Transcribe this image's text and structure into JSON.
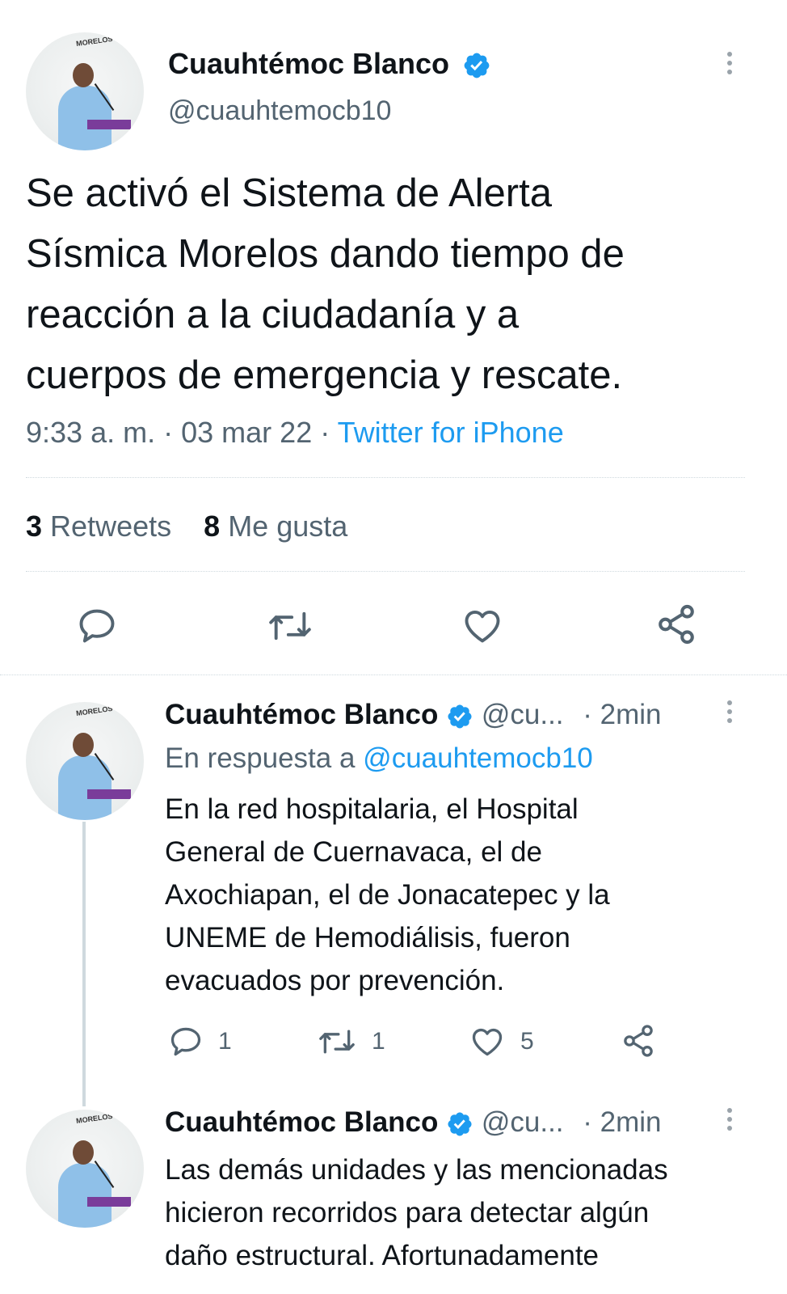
{
  "main_tweet": {
    "author_name": "Cuauhtémoc Blanco",
    "handle": "@cuauhtemocb10",
    "avatar_tag": "MORELOS",
    "text": "Se activó el Sistema de Alerta\nSísmica Morelos dando tiempo de\nreacción a la ciudadanía y a\ncuerpos de emergencia y rescate.",
    "time": "9:33 a. m.",
    "date": "03 mar 22",
    "separator": "·",
    "source": "Twitter for iPhone",
    "retweets_count": "3",
    "retweets_label": "Retweets",
    "likes_count": "8",
    "likes_label": "Me gusta"
  },
  "reply_1": {
    "author_name": "Cuauhtémoc Blanco",
    "handle": "@cu...",
    "time": "· 2min",
    "in_reply_prefix": "En respuesta a",
    "in_reply_handle": "@cuauhtemocb10",
    "text": "En la red hospitalaria, el Hospital\nGeneral de Cuernavaca, el de\nAxochiapan, el de Jonacatepec y la\nUNEME de Hemodiálisis, fueron\nevacuados por prevención.",
    "reply_count": "1",
    "retweet_count": "1",
    "like_count": "5"
  },
  "reply_2": {
    "author_name": "Cuauhtémoc Blanco",
    "handle": "@cu...",
    "time": "· 2min",
    "text": "Las demás unidades y las mencionadas\nhicieron recorridos para detectar algún\ndaño estructural. Afortunadamente"
  },
  "colors": {
    "accent": "#1d9bf0",
    "secondary_text": "#536471",
    "text": "#0f1419"
  },
  "icons": [
    "verified-badge-icon",
    "more-options-icon",
    "reply-icon",
    "retweet-icon",
    "like-icon",
    "share-icon"
  ]
}
